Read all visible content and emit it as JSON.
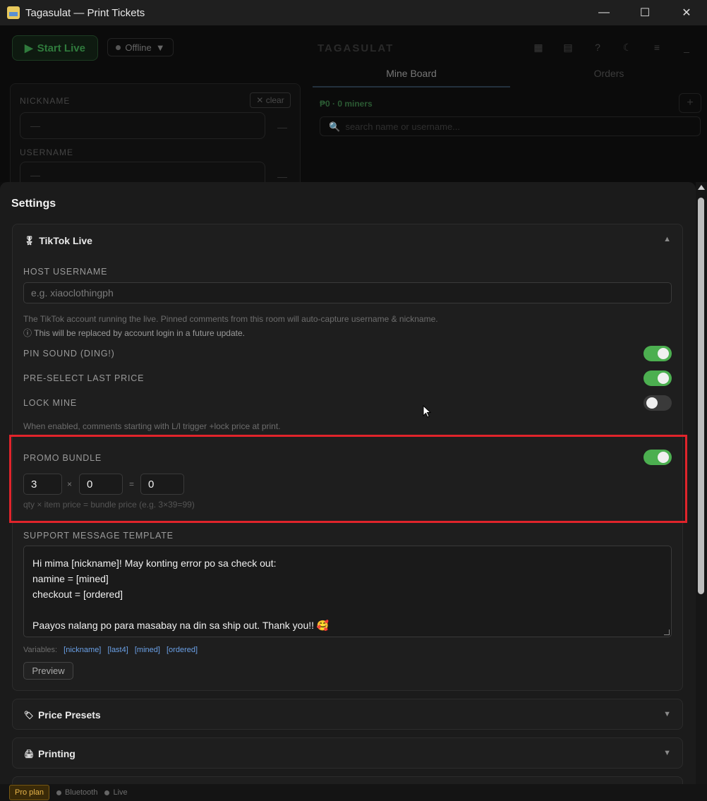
{
  "window": {
    "title": "Tagasulat — Print Tickets",
    "minimize": "—",
    "maximize": "☐",
    "close": "✕"
  },
  "backdrop": {
    "start_live": "Start Live",
    "status": "Offline",
    "brand": "TAGASULAT",
    "nickname_label": "NICKNAME",
    "nickname_value": "—",
    "username_label": "USERNAME",
    "username_value": "—",
    "clear": "clear",
    "tabs": [
      "Mine Board",
      "Orders"
    ],
    "miners": "₱0 · 0 miners",
    "search_placeholder": "search name or username..."
  },
  "settings": {
    "title": "Settings",
    "tiktok": {
      "header": "TikTok Live",
      "host_label": "HOST USERNAME",
      "host_placeholder": "e.g. xiaoclothingph",
      "host_hint": "The TikTok account running the live. Pinned comments from this room will auto-capture username & nickname.",
      "host_note": "This will be replaced by account login in a future update.",
      "pin_sound_label": "PIN SOUND (DING!)",
      "pin_sound_on": true,
      "preselect_label": "PRE-SELECT LAST PRICE",
      "preselect_on": true,
      "lock_mine_label": "LOCK MINE",
      "lock_mine_on": false,
      "lock_hint": "When enabled, comments starting with L/l trigger +lock price at print.",
      "promo_label": "PROMO BUNDLE",
      "promo_on": true,
      "promo_qty": "3",
      "promo_item_price": "0",
      "promo_bundle_price": "0",
      "times_sign": "×",
      "equals_sign": "=",
      "promo_hint": "qty × item price = bundle price  (e.g. 3×39=99)",
      "support_label": "SUPPORT MESSAGE TEMPLATE",
      "support_lines": [
        "Hi mima [nickname]! May konting error po sa check out:",
        "namine = [mined]",
        "checkout = [ordered]",
        "",
        "Paayos nalang po para masabay na din sa ship out. Thank you!! 🥰"
      ],
      "variables_label": "Variables:",
      "variables": [
        "[nickname]",
        "[last4]",
        "[mined]",
        "[ordered]"
      ],
      "preview": "Preview"
    },
    "price_presets": {
      "header": "Price Presets"
    },
    "printing": {
      "header": "Printing"
    }
  },
  "statusbar": {
    "plan": "Pro plan",
    "bluetooth": "Bluetooth",
    "live": "Live"
  }
}
